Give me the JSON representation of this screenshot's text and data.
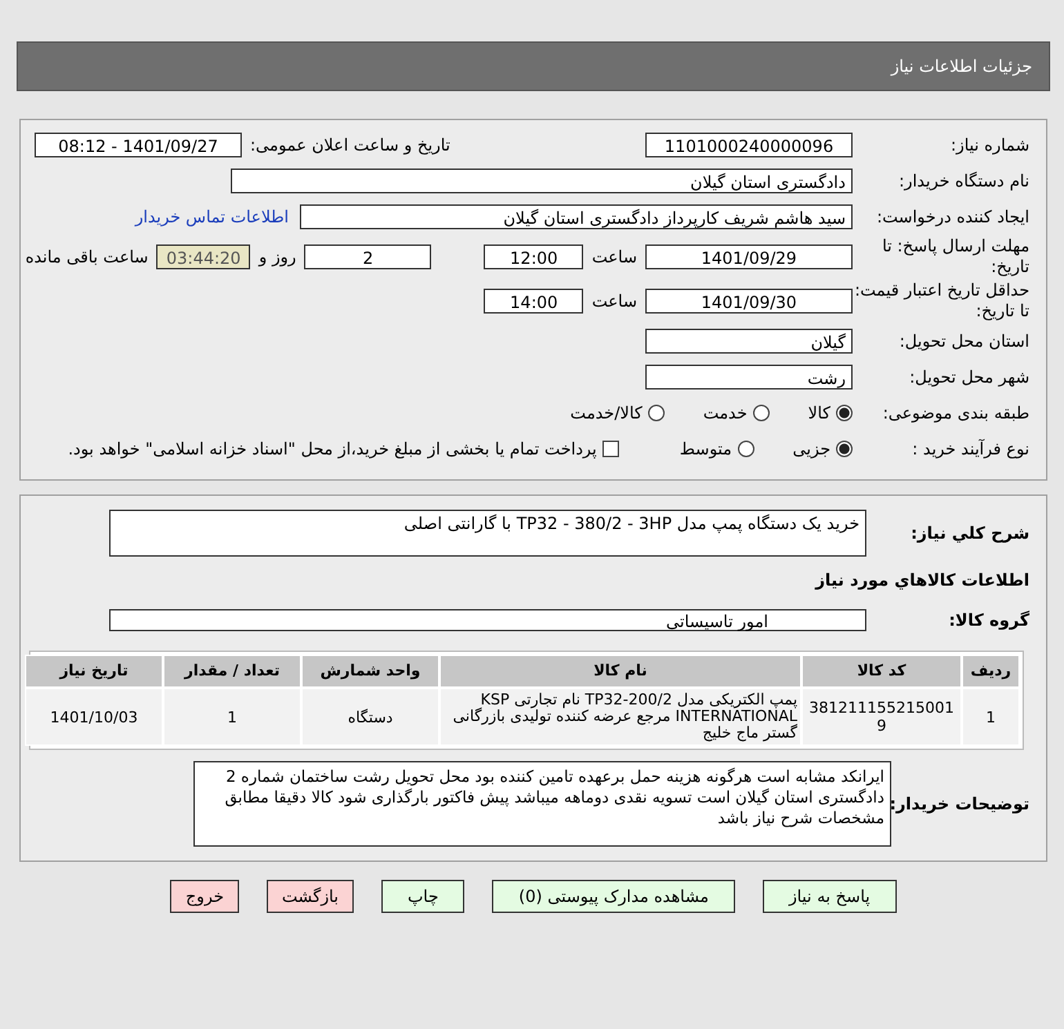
{
  "header": {
    "title": "جزئیات اطلاعات نیاز"
  },
  "details": {
    "need_number": {
      "label": "شماره نیاز:",
      "value": "1101000240000096"
    },
    "announce": {
      "label": "تاریخ و ساعت اعلان عمومی:",
      "value": "1401/09/27 - 08:12"
    },
    "buyer_org": {
      "label": "نام دستگاه خریدار:",
      "value": "دادگستری استان گیلان"
    },
    "requester": {
      "label": "ایجاد کننده درخواست:",
      "value": "سید هاشم شریف کارپرداز دادگستری استان گیلان",
      "link": "اطلاعات تماس خریدار"
    },
    "deadline": {
      "label": "مهلت ارسال پاسخ: تا تاریخ:",
      "date": "1401/09/29",
      "time_label": "ساعت",
      "time": "12:00",
      "days": "2",
      "days_label": "روز و",
      "remaining": "03:44:20",
      "remaining_label": "ساعت باقی مانده"
    },
    "validity": {
      "label": "حداقل تاریخ اعتبار قیمت: تا تاریخ:",
      "date": "1401/09/30",
      "time_label": "ساعت",
      "time": "14:00"
    },
    "province": {
      "label": "استان محل تحویل:",
      "value": "گیلان"
    },
    "city": {
      "label": "شهر محل تحویل:",
      "value": "رشت"
    },
    "category": {
      "label": "طبقه بندی موضوعی:",
      "options": [
        {
          "label": "کالا",
          "selected": true
        },
        {
          "label": "خدمت",
          "selected": false
        },
        {
          "label": "کالا/خدمت",
          "selected": false
        }
      ]
    },
    "process": {
      "label": "نوع فرآیند خرید :",
      "options": [
        {
          "label": "جزیی",
          "selected": true
        },
        {
          "label": "متوسط",
          "selected": false
        }
      ],
      "payment": {
        "label": "پرداخت تمام یا بخشی از مبلغ خرید،از محل \"اسناد خزانه اسلامی\" خواهد بود.",
        "checked": false
      }
    }
  },
  "summary": {
    "label": "شرح کلي نياز:",
    "value": "خرید یک دستگاه پمپ مدل TP32 - 380/2 - 3HP   با گارانتی اصلی"
  },
  "goods": {
    "title": "اطلاعات کالاهاي مورد نياز",
    "group_label": "گروه کالا:",
    "group": "امور تاسیساتی",
    "columns": [
      "ردیف",
      "کد کالا",
      "نام کالا",
      "واحد شمارش",
      "تعداد / مقدار",
      "تاریخ نیاز"
    ],
    "rows": [
      {
        "cells": [
          "1",
          "3812111552150019",
          "پمپ الکتریکی مدل TP32-200/2 نام تجارتی KSP INTERNATIONAL مرجع عرضه کننده تولیدی بازرگانی گستر ماج خلیج",
          "دستگاه",
          "1",
          "1401/10/03"
        ]
      }
    ]
  },
  "notes": {
    "label": "توضیحات خریدار:",
    "value": "ایرانکد مشابه است هرگونه هزینه حمل برعهده تامین کننده بود محل تحویل رشت ساختمان شماره 2 دادگستری استان گیلان است تسویه نقدی دوماهه میباشد پیش فاکتور بارگذاری شود کالا دقیقا مطابق مشخصات شرح نیاز باشد"
  },
  "buttons": [
    {
      "label": "پاسخ به نیاز",
      "kind": "normal"
    },
    {
      "label": "مشاهده مدارک پیوستی (0)",
      "kind": "normal"
    },
    {
      "label": "چاپ",
      "kind": "normal"
    },
    {
      "label": "بازگشت",
      "kind": "danger"
    },
    {
      "label": "خروج",
      "kind": "danger"
    }
  ]
}
